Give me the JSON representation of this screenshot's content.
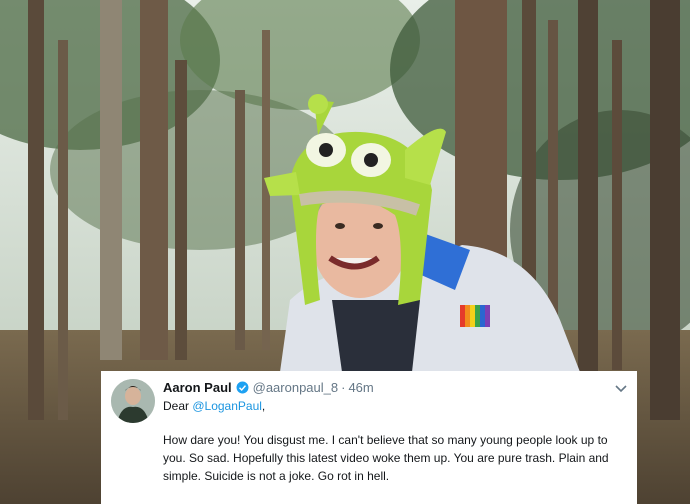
{
  "tweet": {
    "author_name": "Aaron Paul",
    "handle": "@aaronpaul_8",
    "separator": "·",
    "timestamp": "46m",
    "greeting_prefix": "Dear ",
    "mention": "@LoganPaul",
    "greeting_suffix": ",",
    "text": "How dare you! You disgust me. I can't believe that so many young people look up to you. So sad. Hopefully this latest video woke them up. You are pure trash. Plain and simple. Suicide is not a joke. Go rot in hell.",
    "verified_icon": "verified-badge-icon",
    "menu_icon": "chevron-down-icon"
  },
  "colors": {
    "link": "#1b95e0",
    "verified": "#1da1f2",
    "muted": "#657786",
    "text": "#14171a",
    "hat_green": "#a8d63b",
    "forest_floor": "#6b5a43"
  }
}
